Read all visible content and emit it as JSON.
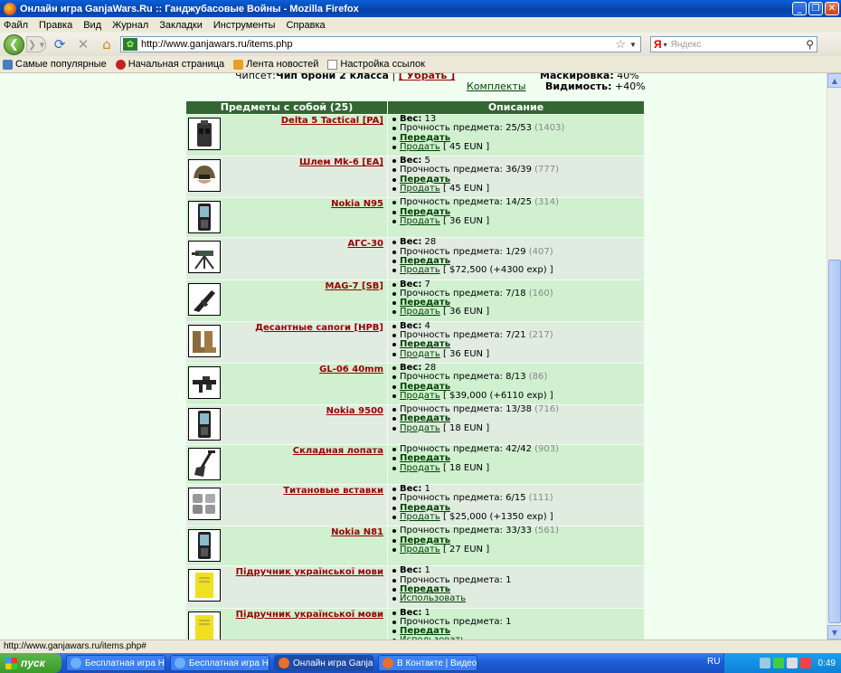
{
  "window": {
    "title": "Онлайн игра GanjaWars.Ru :: Ганджубасовые Войны - Mozilla Firefox"
  },
  "menu": [
    "Файл",
    "Правка",
    "Вид",
    "Журнал",
    "Закладки",
    "Инструменты",
    "Справка"
  ],
  "nav": {
    "url": "http://www.ganjawars.ru/items.php",
    "search_placeholder": "Яндекс",
    "search_engine": "Я"
  },
  "bookmarks": [
    "Самые популярные",
    "Начальная страница",
    "Лента новостей",
    "Настройка ссылок"
  ],
  "top_info": {
    "chipset_label": "Чипсет:",
    "chipset_value": "Чип брони 2 класса",
    "chipset_remove": "[ Убрать ]",
    "kits_link": "Комплекты",
    "mask_label": "Маскировка:",
    "mask_value": "40%",
    "visibility_label": "Видимость:",
    "visibility_value": "+40%"
  },
  "table": {
    "header_left": "Предметы с собой (25)",
    "header_right": "Описание",
    "labels": {
      "weight": "Вес:",
      "durability": "Прочность предмета:",
      "transfer": "Передать",
      "sell": "Продать",
      "use": "Использовать"
    },
    "items": [
      {
        "name": "Delta 5 Tactical [PA]",
        "icon": "tactical-vest-icon",
        "weight": "13",
        "durability": "25/53",
        "dur_extra": "(1403)",
        "action": "sell",
        "price": "[ 45 EUN ]"
      },
      {
        "name": "Шлем Mk-6 [EA]",
        "icon": "helmet-icon",
        "weight": "5",
        "durability": "36/39",
        "dur_extra": "(777)",
        "action": "sell",
        "price": "[ 45 EUN ]"
      },
      {
        "name": "Nokia N95",
        "icon": "phone-icon",
        "weight": "",
        "durability": "14/25",
        "dur_extra": "(314)",
        "action": "sell",
        "price": "[ 36 EUN ]"
      },
      {
        "name": "АГС-30",
        "icon": "grenade-launcher-icon",
        "weight": "28",
        "durability": "1/29",
        "dur_extra": "(407)",
        "action": "sell",
        "price": "[ $72,500 (+4300 exp) ]"
      },
      {
        "name": "MAG-7 [SB]",
        "icon": "shotgun-icon",
        "weight": "7",
        "durability": "7/18",
        "dur_extra": "(160)",
        "action": "sell",
        "price": "[ 36 EUN ]"
      },
      {
        "name": "Десантные сапоги [HPB]",
        "icon": "boots-icon",
        "weight": "4",
        "durability": "7/21",
        "dur_extra": "(217)",
        "action": "sell",
        "price": "[ 36 EUN ]"
      },
      {
        "name": "GL-06 40mm",
        "icon": "rifle-icon",
        "weight": "28",
        "durability": "8/13",
        "dur_extra": "(86)",
        "action": "sell",
        "price": "[ $39,000 (+6110 exp) ]"
      },
      {
        "name": "Nokia 9500",
        "icon": "phone-icon",
        "weight": "",
        "durability": "13/38",
        "dur_extra": "(716)",
        "action": "sell",
        "price": "[ 18 EUN ]"
      },
      {
        "name": "Складная лопата",
        "icon": "shovel-icon",
        "weight": "",
        "durability": "42/42",
        "dur_extra": "(903)",
        "action": "sell",
        "price": "[ 18 EUN ]"
      },
      {
        "name": "Титановые вставки",
        "icon": "armor-inserts-icon",
        "weight": "1",
        "durability": "6/15",
        "dur_extra": "(111)",
        "action": "sell",
        "price": "[ $25,000 (+1350 exp) ]"
      },
      {
        "name": "Nokia N81",
        "icon": "phone-icon",
        "weight": "",
        "durability": "33/33",
        "dur_extra": "(561)",
        "action": "sell",
        "price": "[ 27 EUN ]"
      },
      {
        "name": "Підручник української мови",
        "icon": "book-icon",
        "weight": "1",
        "durability": "1",
        "dur_extra": "",
        "action": "use",
        "price": ""
      },
      {
        "name": "Підручник української мови",
        "icon": "book-icon",
        "weight": "1",
        "durability": "1",
        "dur_extra": "",
        "action": "use",
        "price": ""
      }
    ]
  },
  "status": "http://www.ganjawars.ru/items.php#",
  "taskbar": {
    "start": "пуск",
    "tasks": [
      "Бесплатная игра Но...",
      "Бесплатная игра Но...",
      "Онлайн игра Ganja...",
      "В Контакте | Видео ..."
    ],
    "active_index": 2,
    "lang": "RU",
    "clock": "0:49"
  }
}
